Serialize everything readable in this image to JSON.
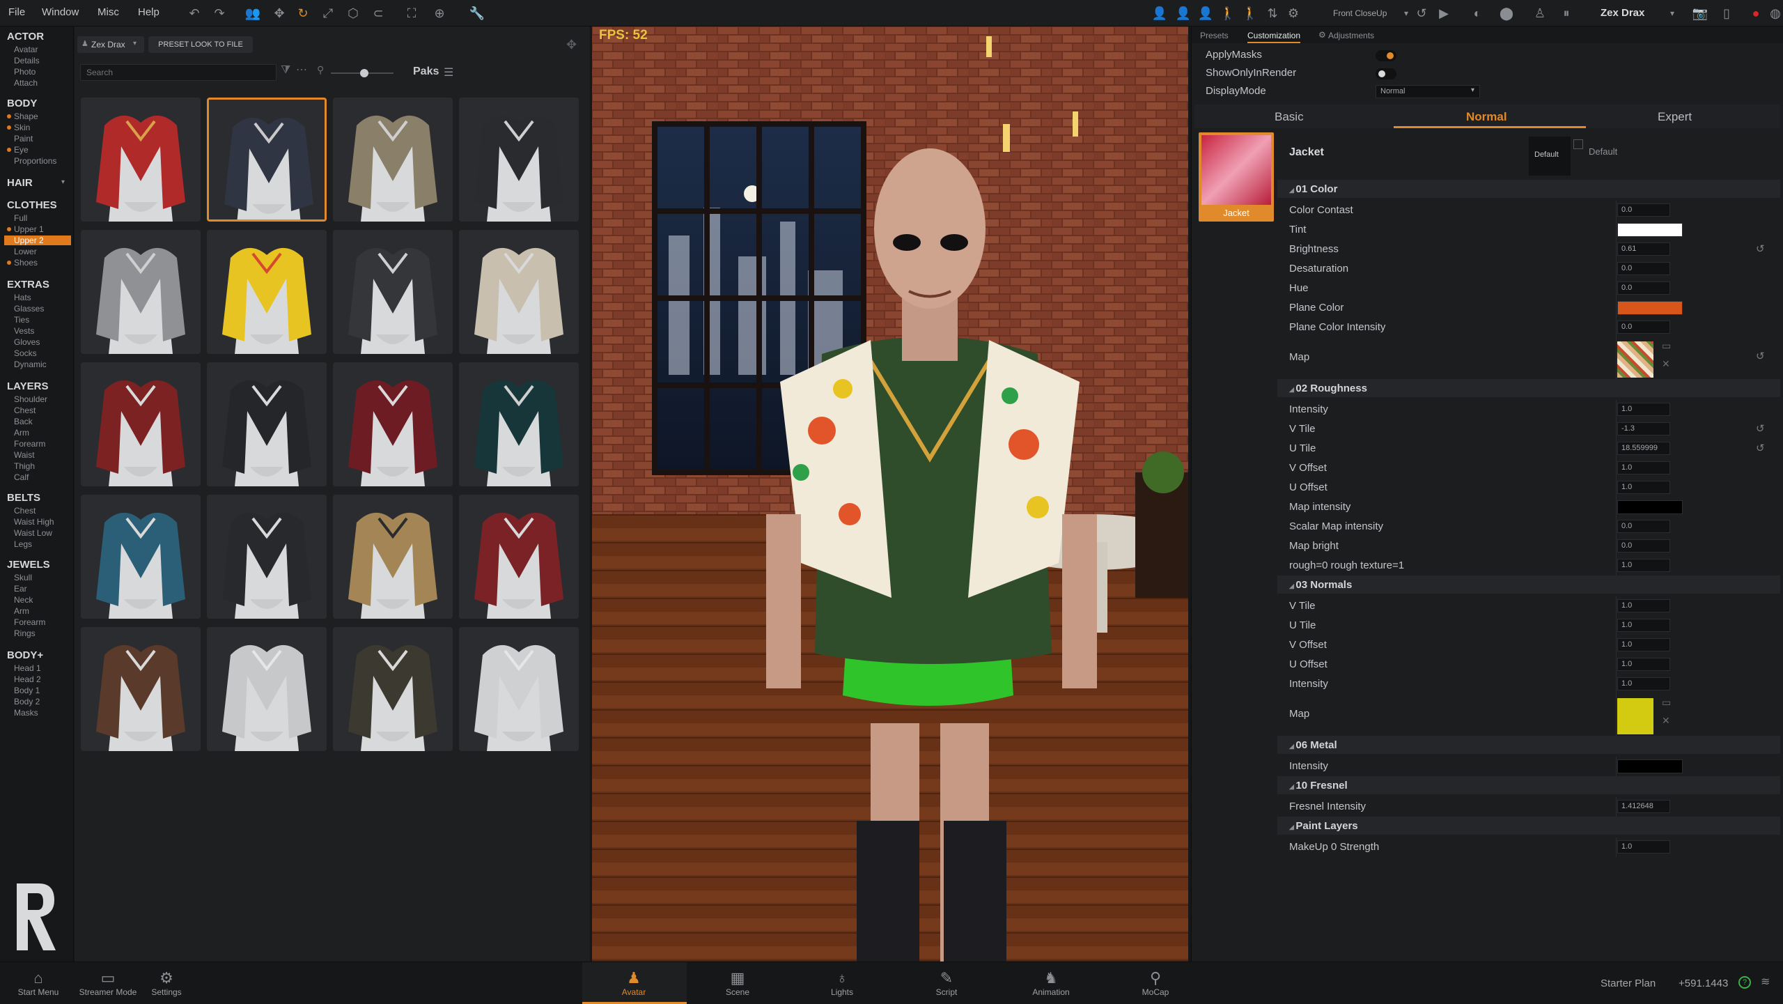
{
  "menu": [
    "File",
    "Window",
    "Misc",
    "Help"
  ],
  "toolbar_icons": [
    "undo-icon",
    "redo-icon",
    "people-icon",
    "move-icon",
    "rotate-icon",
    "scale-icon",
    "box-icon",
    "link-icon",
    "frame-icon",
    "target-icon",
    "wrench-icon"
  ],
  "top_right": {
    "camera_label": "Front CloseUp",
    "profile": "Zex Drax"
  },
  "left_nav": [
    {
      "label": "ACTOR",
      "items": [
        "Avatar",
        "Details",
        "Photo",
        "Attach"
      ]
    },
    {
      "label": "BODY",
      "items": [
        "Shape",
        "Skin",
        "Paint",
        "Eye",
        "Proportions"
      ]
    },
    {
      "label": "HAIR",
      "items": []
    },
    {
      "label": "CLOTHES",
      "items": [
        "Full",
        "Upper 1",
        "Upper 2",
        "Lower",
        "Shoes"
      ]
    },
    {
      "label": "EXTRAS",
      "items": [
        "Hats",
        "Glasses",
        "Ties",
        "Vests",
        "Gloves",
        "Socks",
        "Dynamic"
      ]
    },
    {
      "label": "LAYERS",
      "items": [
        "Shoulder",
        "Chest",
        "Back",
        "Arm",
        "Forearm",
        "Waist",
        "Thigh",
        "Calf"
      ]
    },
    {
      "label": "BELTS",
      "items": [
        "Chest",
        "Waist High",
        "Waist Low",
        "Legs"
      ]
    },
    {
      "label": "JEWELS",
      "items": [
        "Skull",
        "Ear",
        "Neck",
        "Arm",
        "Forearm",
        "Rings"
      ]
    },
    {
      "label": "BODY+",
      "items": [
        "Head 1",
        "Head 2",
        "Body 1",
        "Body 2",
        "Masks"
      ]
    }
  ],
  "panel": {
    "actor_chip": "Zex Drax",
    "preset_button": "PRESET LOOK TO FILE",
    "search_placeholder": "Search",
    "paks_label": "Paks"
  },
  "thumbs": [
    {
      "color": "#b02a2a",
      "accent": "#d8a24a"
    },
    {
      "color": "#2f3542",
      "accent": "#c9c9c9"
    },
    {
      "color": "#8a7f68",
      "accent": "#cfcfcf"
    },
    {
      "color": "#2a2b2e",
      "accent": "#cfcfcf"
    },
    {
      "color": "#8f9194",
      "accent": "#cfcfcf"
    },
    {
      "color": "#e8c422",
      "accent": "#d5492f"
    },
    {
      "color": "#34363a",
      "accent": "#cfcfcf"
    },
    {
      "color": "#c9bfae",
      "accent": "#d9d9d9"
    },
    {
      "color": "#7c2222",
      "accent": "#d9d9d9"
    },
    {
      "color": "#252629",
      "accent": "#d9d9d9"
    },
    {
      "color": "#6e1c24",
      "accent": "#d9d9d9"
    },
    {
      "color": "#16363a",
      "accent": "#cfcfcf"
    },
    {
      "color": "#2a5f77",
      "accent": "#d9d9d9"
    },
    {
      "color": "#28292c",
      "accent": "#d9d9d9"
    },
    {
      "color": "#a48656",
      "accent": "#2b2b2b"
    },
    {
      "color": "#7a2226",
      "accent": "#d9d9d9"
    },
    {
      "color": "#5a3a2a",
      "accent": "#d9d9d9"
    },
    {
      "color": "#c7c8ca",
      "accent": "#e6e6e6"
    },
    {
      "color": "#3c3a30",
      "accent": "#d9d9d9"
    },
    {
      "color": "#cfd0d2",
      "accent": "#e6e6e6"
    }
  ],
  "viewport": {
    "fps": "FPS: 52"
  },
  "right_tabs": [
    "Presets",
    "Customization",
    "Adjustments"
  ],
  "toggles": [
    {
      "label": "ApplyMasks"
    },
    {
      "label": "ShowOnlyInRender"
    },
    {
      "label": "DisplayMode",
      "value": "Normal"
    }
  ],
  "mode_tabs": [
    "Basic",
    "Normal",
    "Expert"
  ],
  "material": {
    "thumb_label": "Jacket",
    "name": "Jacket",
    "default_btn": "Default",
    "default_label": "Default"
  },
  "rows": [
    {
      "t": "s",
      "label": "01 Color"
    },
    {
      "t": "r",
      "label": "Color Contast",
      "value": "0.0"
    },
    {
      "t": "c",
      "label": "Tint",
      "color": "#ffffff"
    },
    {
      "t": "r",
      "label": "Brightness",
      "value": "0.61",
      "reset": true
    },
    {
      "t": "r",
      "label": "Desaturation",
      "value": "0.0"
    },
    {
      "t": "r",
      "label": "Hue",
      "value": "0.0"
    },
    {
      "t": "c",
      "label": "Plane Color",
      "color": "#d8561a"
    },
    {
      "t": "r",
      "label": "Plane Color Intensity",
      "value": "0.0"
    },
    {
      "t": "m",
      "label": "Map",
      "map": "pattern",
      "reset": true
    },
    {
      "t": "s",
      "label": "02 Roughness"
    },
    {
      "t": "r",
      "label": "Intensity",
      "value": "1.0"
    },
    {
      "t": "r",
      "label": "V Tile",
      "value": "-1.3",
      "reset": true
    },
    {
      "t": "r",
      "label": "U Tile",
      "value": "18.559999",
      "reset": true
    },
    {
      "t": "r",
      "label": "V Offset",
      "value": "1.0"
    },
    {
      "t": "r",
      "label": "U Offset",
      "value": "1.0"
    },
    {
      "t": "c",
      "label": "Map intensity",
      "color": "#000000"
    },
    {
      "t": "r",
      "label": "Scalar Map intensity",
      "value": "0.0"
    },
    {
      "t": "r",
      "label": "Map bright",
      "value": "0.0"
    },
    {
      "t": "r",
      "label": "rough=0 rough texture=1",
      "value": "1.0"
    },
    {
      "t": "s",
      "label": "03 Normals"
    },
    {
      "t": "r",
      "label": "V Tile",
      "value": "1.0"
    },
    {
      "t": "r",
      "label": "U Tile",
      "value": "1.0"
    },
    {
      "t": "r",
      "label": "V Offset",
      "value": "1.0"
    },
    {
      "t": "r",
      "label": "U Offset",
      "value": "1.0"
    },
    {
      "t": "r",
      "label": "Intensity",
      "value": "1.0"
    },
    {
      "t": "m",
      "label": "Map",
      "map": "yellow"
    },
    {
      "t": "s",
      "label": "06 Metal"
    },
    {
      "t": "c",
      "label": "Intensity",
      "color": "#000000"
    },
    {
      "t": "s",
      "label": "10 Fresnel"
    },
    {
      "t": "r",
      "label": "Fresnel Intensity",
      "value": "1.412648"
    },
    {
      "t": "s",
      "label": "Paint Layers"
    },
    {
      "t": "r",
      "label": "MakeUp 0 Strength",
      "value": "1.0"
    }
  ],
  "bottom_left": [
    {
      "label": "Start Menu",
      "icon": "home-icon",
      "glyph": "⌂"
    },
    {
      "label": "Streamer Mode",
      "icon": "streamer-icon",
      "glyph": "▭"
    },
    {
      "label": "Settings",
      "icon": "gear-icon",
      "glyph": "⚙"
    }
  ],
  "bottom_tabs": [
    {
      "label": "Avatar",
      "icon": "avatar-icon",
      "glyph": "♟",
      "active": true
    },
    {
      "label": "Scene",
      "icon": "scene-icon",
      "glyph": "▦"
    },
    {
      "label": "Lights",
      "icon": "light-icon",
      "glyph": "♁"
    },
    {
      "label": "Script",
      "icon": "script-icon",
      "glyph": "✎"
    },
    {
      "label": "Animation",
      "icon": "animation-icon",
      "glyph": "♞"
    },
    {
      "label": "MoCap",
      "icon": "mocap-icon",
      "glyph": "⚲"
    }
  ],
  "status": {
    "plan": "Starter Plan",
    "coords": "+591.1443"
  }
}
